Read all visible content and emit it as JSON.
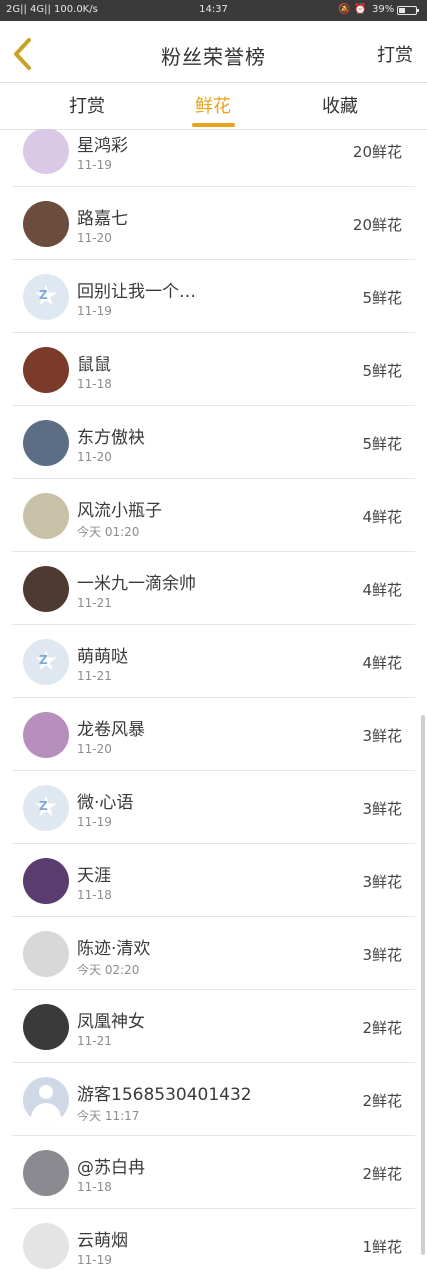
{
  "status_bar": {
    "left": "2G|| 4G|| 100.0K/s",
    "time": "14:37",
    "bell": "🔕",
    "alarm": "⏰",
    "battery": "39%",
    "battery_level": 0.39
  },
  "header": {
    "title": "粉丝荣誉榜",
    "right_button": "打赏",
    "back_icon": "chevron-left-icon",
    "accent": "#e8a21c"
  },
  "tabs": [
    {
      "label": "打赏",
      "active": false
    },
    {
      "label": "鲜花",
      "active": true
    },
    {
      "label": "收藏",
      "active": false
    }
  ],
  "rows": [
    {
      "name": "星鸿彩",
      "date": "11-19",
      "amount": "20鲜花",
      "avatar": "#d9c9e6"
    },
    {
      "name": "路嘉七",
      "date": "11-20",
      "amount": "20鲜花",
      "avatar": "#6b4c3d"
    },
    {
      "name": "回别让我一个…",
      "date": "11-19",
      "amount": "5鲜花",
      "avatar": "qq"
    },
    {
      "name": "鼠鼠",
      "date": "11-18",
      "amount": "5鲜花",
      "avatar": "#7a3b2a"
    },
    {
      "name": "东方傲袂",
      "date": "11-20",
      "amount": "5鲜花",
      "avatar": "#5c6d86"
    },
    {
      "name": "风流小瓶子",
      "date": "今天 01:20",
      "amount": "4鲜花",
      "avatar": "#c9c0a8"
    },
    {
      "name": "一米九一滴余帅",
      "date": "11-21",
      "amount": "4鲜花",
      "avatar": "#4f3a32"
    },
    {
      "name": "萌萌哒",
      "date": "11-21",
      "amount": "4鲜花",
      "avatar": "qq"
    },
    {
      "name": "龙卷风暴",
      "date": "11-20",
      "amount": "3鲜花",
      "avatar": "#b68fbd"
    },
    {
      "name": "微·心语",
      "date": "11-19",
      "amount": "3鲜花",
      "avatar": "qq"
    },
    {
      "name": "天涯",
      "date": "11-18",
      "amount": "3鲜花",
      "avatar": "#5a3d6e"
    },
    {
      "name": "陈迹·清欢",
      "date": "今天 02:20",
      "amount": "3鲜花",
      "avatar": "#d8d8d8"
    },
    {
      "name": "凤凰神女",
      "date": "11-21",
      "amount": "2鲜花",
      "avatar": "#3a3a3a"
    },
    {
      "name": "游客1568530401432",
      "date": "今天 11:17",
      "amount": "2鲜花",
      "avatar": "person"
    },
    {
      "name": "@苏白冉",
      "date": "11-18",
      "amount": "2鲜花",
      "avatar": "#8a8a90"
    },
    {
      "name": "云萌烟",
      "date": "11-19",
      "amount": "1鲜花",
      "avatar": "#e4e4e4"
    }
  ]
}
